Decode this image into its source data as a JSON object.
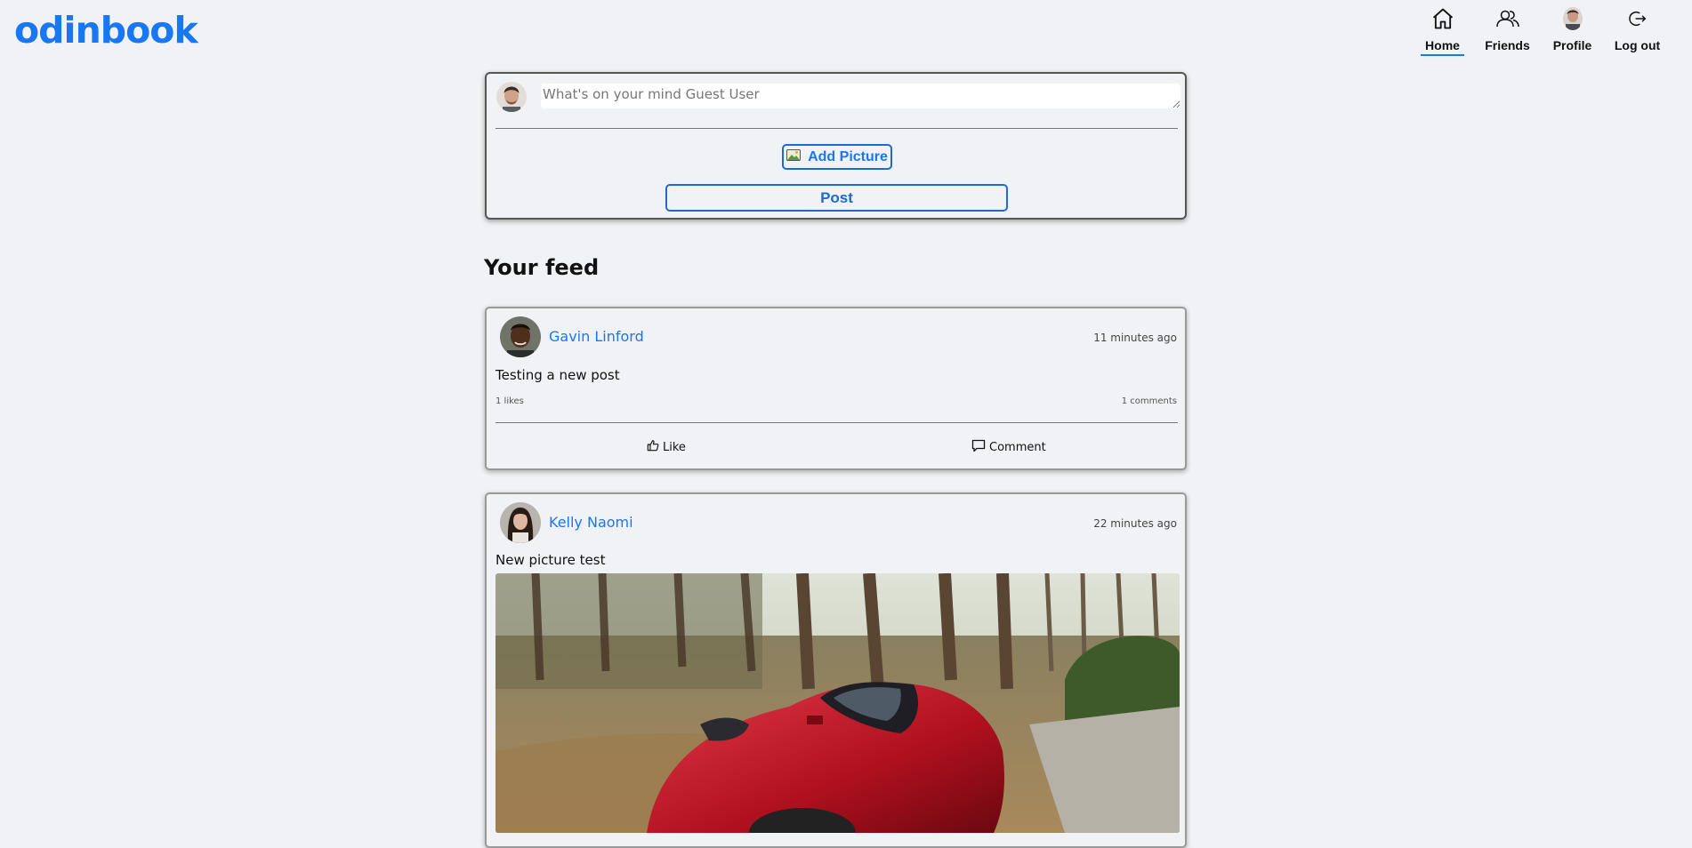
{
  "header": {
    "logo": "odinbook"
  },
  "nav": [
    {
      "label": "Home",
      "icon": "home-icon",
      "active": true
    },
    {
      "label": "Friends",
      "icon": "friends-icon",
      "active": false
    },
    {
      "label": "Profile",
      "icon": "profile-avatar",
      "active": false
    },
    {
      "label": "Log out",
      "icon": "logout-icon",
      "active": false
    }
  ],
  "composer": {
    "placeholder": "What's on your mind Guest User",
    "add_picture_label": "Add Picture",
    "post_label": "Post"
  },
  "feed": {
    "title": "Your feed",
    "posts": [
      {
        "author": "Gavin Linford",
        "time": "11 minutes ago",
        "text": "Testing a new post",
        "likes": "1 likes",
        "comments": "1 comments",
        "like_label": "Like",
        "comment_label": "Comment"
      },
      {
        "author": "Kelly Naomi",
        "time": "22 minutes ago",
        "text": "New picture test"
      }
    ]
  },
  "colors": {
    "brand": "#1877f2",
    "background": "#f0f2f5"
  }
}
